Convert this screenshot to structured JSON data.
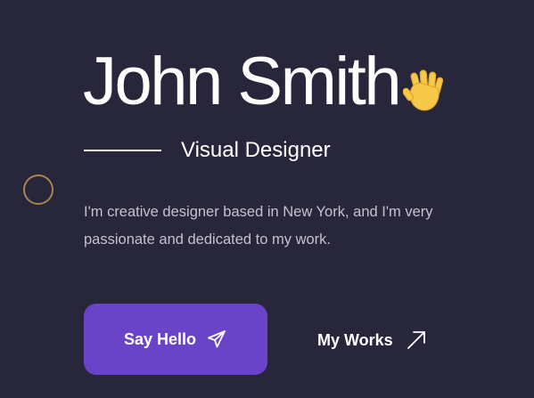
{
  "hero": {
    "name": "John Smith",
    "wave_icon": "waving-hand-icon",
    "role": "Visual Designer",
    "bio": "I'm creative designer based in New York, and I'm very passionate and dedicated to my work."
  },
  "actions": {
    "primary_label": "Say Hello",
    "primary_icon": "send-icon",
    "secondary_label": "My Works",
    "secondary_icon": "arrow-up-right-icon"
  },
  "colors": {
    "background": "#27263a",
    "accent": "#6944c8",
    "ring": "#a8844e",
    "text": "#ffffff",
    "muted_text": "#c4c2cf"
  }
}
